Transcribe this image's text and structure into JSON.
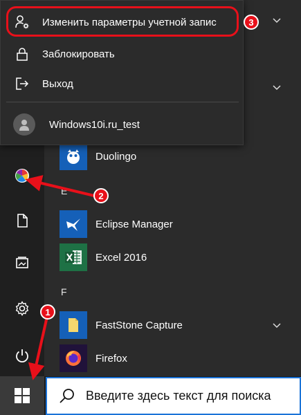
{
  "account_menu": {
    "items": [
      {
        "label": "Изменить параметры учетной запис",
        "icon": "person-gear-icon"
      },
      {
        "label": "Заблокировать",
        "icon": "lock-icon"
      },
      {
        "label": "Выход",
        "icon": "sign-out-icon"
      }
    ],
    "user": {
      "name": "Windows10i.ru_test",
      "icon": "user-avatar-icon"
    }
  },
  "app_list": {
    "groups": [
      {
        "letter": "",
        "apps": [
          {
            "label": "Duolingo",
            "icon": "duolingo-icon"
          }
        ]
      },
      {
        "letter": "E",
        "apps": [
          {
            "label": "Eclipse Manager",
            "icon": "eclipse-manager-icon"
          },
          {
            "label": "Excel 2016",
            "icon": "excel-icon"
          }
        ]
      },
      {
        "letter": "F",
        "apps": [
          {
            "label": "FastStone Capture",
            "icon": "folder-icon"
          },
          {
            "label": "Firefox",
            "icon": "firefox-icon"
          }
        ]
      }
    ]
  },
  "rail": [
    "account-avatar-icon",
    "documents-icon",
    "pictures-icon",
    "settings-icon",
    "power-icon"
  ],
  "annotations": [
    "1",
    "2",
    "3"
  ],
  "taskbar": {
    "search_placeholder": "Введите здесь текст для поиска"
  },
  "colors": {
    "accent_red": "#e8101a",
    "tile_blue": "#1560b8",
    "excel_green": "#1e7145",
    "search_border": "#1a73d8"
  }
}
